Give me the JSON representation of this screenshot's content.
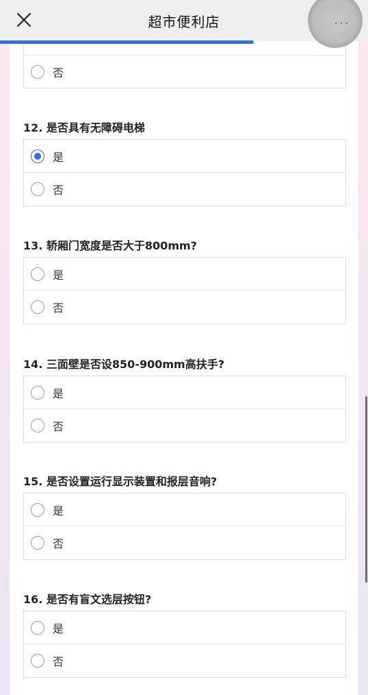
{
  "header": {
    "title": "超市便利店",
    "more_label": "···"
  },
  "progress": {
    "fraction": 0.69
  },
  "partial_option": {
    "label": "否"
  },
  "questions": [
    {
      "title": "12. 是否具有无障碍电梯",
      "options": [
        {
          "label": "是",
          "checked": true
        },
        {
          "label": "否",
          "checked": false
        }
      ]
    },
    {
      "title": "13. 轿厢门宽度是否大于800mm?",
      "options": [
        {
          "label": "是",
          "checked": false
        },
        {
          "label": "否",
          "checked": false
        }
      ]
    },
    {
      "title": "14. 三面壁是否设850-900mm高扶手?",
      "options": [
        {
          "label": "是",
          "checked": false
        },
        {
          "label": "否",
          "checked": false
        }
      ]
    },
    {
      "title": "15. 是否设置运行显示装置和报层音响?",
      "options": [
        {
          "label": "是",
          "checked": false
        },
        {
          "label": "否",
          "checked": false
        }
      ]
    },
    {
      "title": "16. 是否有盲文选层按钮?",
      "options": [
        {
          "label": "是",
          "checked": false
        },
        {
          "label": "否",
          "checked": false
        }
      ]
    }
  ]
}
